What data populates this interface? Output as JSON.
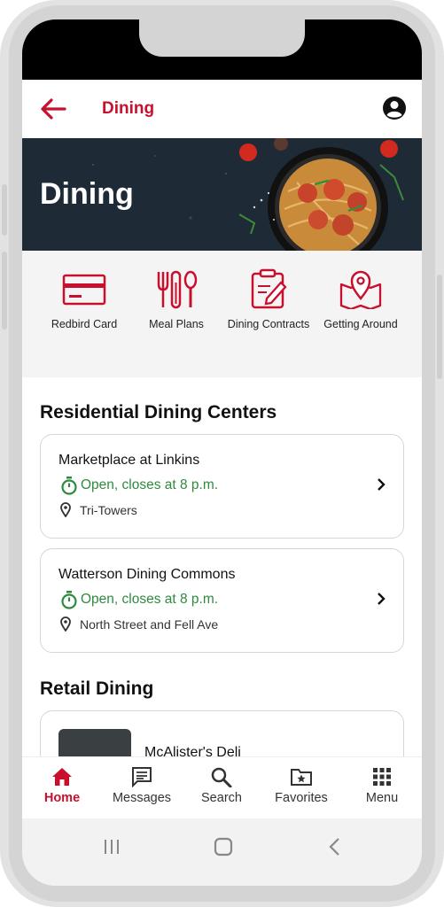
{
  "appbar": {
    "title": "Dining",
    "back_icon": "arrow-left-icon",
    "account_icon": "account-circle-icon",
    "accent": "#c8102e"
  },
  "hero": {
    "title": "Dining"
  },
  "quick_links": [
    {
      "label": "Redbird Card",
      "icon": "credit-card-icon"
    },
    {
      "label": "Meal Plans",
      "icon": "utensils-icon"
    },
    {
      "label": "Dining Contracts",
      "icon": "clipboard-pen-icon"
    },
    {
      "label": "Getting Around",
      "icon": "map-pin-icon"
    }
  ],
  "residential": {
    "title": "Residential Dining Centers",
    "items": [
      {
        "name": "Marketplace at Linkins",
        "status": "Open, closes at 8 p.m.",
        "location": "Tri-Towers"
      },
      {
        "name": "Watterson Dining Commons",
        "status": "Open, closes at 8 p.m.",
        "location": "North Street and Fell Ave"
      }
    ]
  },
  "retail": {
    "title": "Retail Dining",
    "items": [
      {
        "name": "McAlister's Deli"
      }
    ]
  },
  "bottom_nav": [
    {
      "label": "Home",
      "icon": "home-icon",
      "active": true
    },
    {
      "label": "Messages",
      "icon": "message-icon"
    },
    {
      "label": "Search",
      "icon": "search-icon"
    },
    {
      "label": "Favorites",
      "icon": "folder-star-icon"
    },
    {
      "label": "Menu",
      "icon": "grid-icon"
    }
  ],
  "colors": {
    "open_status": "#2e8b3e",
    "hero_bg": "#1f2b37"
  }
}
